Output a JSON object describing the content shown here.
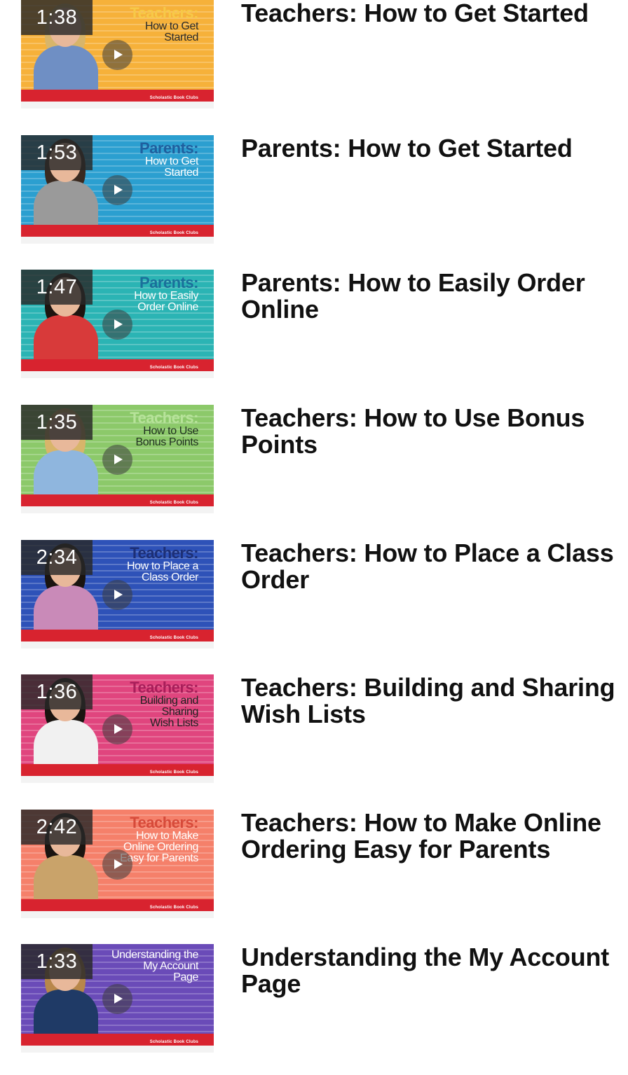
{
  "videos": [
    {
      "duration": "1:38",
      "title": "Teachers: How to Get Started",
      "thumb_heading": "Teachers:",
      "thumb_subheading": "How to Get\nStarted",
      "thumb_brand": "Scholastic Book Clubs",
      "bg_color": "#f6b13a",
      "heading_color": "#f7c948",
      "subheading_color": "#2a2a2a",
      "person_color": "#6f8fc4",
      "hair_color": "#d8b56a"
    },
    {
      "duration": "1:53",
      "title": "Parents: How to Get Started",
      "thumb_heading": "Parents:",
      "thumb_subheading": "How to Get\nStarted",
      "thumb_brand": "Scholastic Book Clubs",
      "bg_color": "#2b9fd0",
      "heading_color": "#1f5f9e",
      "subheading_color": "#ffffff",
      "person_color": "#9a9a9a",
      "hair_color": "#3a2a20"
    },
    {
      "duration": "1:47",
      "title": "Parents: How to Easily Order Online",
      "thumb_heading": "Parents:",
      "thumb_subheading": "How to Easily\nOrder Online",
      "thumb_brand": "Scholastic Book Clubs",
      "bg_color": "#2bb4b4",
      "heading_color": "#1a6f9a",
      "subheading_color": "#ffffff",
      "person_color": "#d83a3a",
      "hair_color": "#1e1410"
    },
    {
      "duration": "1:35",
      "title": "Teachers: How to Use Bonus Points",
      "thumb_heading": "Teachers:",
      "thumb_subheading": "How to Use\nBonus Points",
      "thumb_brand": "Scholastic Book Clubs",
      "bg_color": "#8cc96a",
      "heading_color": "#b7e39a",
      "subheading_color": "#1f2f1f",
      "person_color": "#8fb6de",
      "hair_color": "#d8b56a"
    },
    {
      "duration": "2:34",
      "title": "Teachers: How to Place a Class Order",
      "thumb_heading": "Teachers:",
      "thumb_subheading": "How to Place a\nClass Order",
      "thumb_brand": "Scholastic Book Clubs",
      "bg_color": "#2e52b8",
      "heading_color": "#1d2f75",
      "subheading_color": "#ffffff",
      "person_color": "#c98ab8",
      "hair_color": "#1a1410"
    },
    {
      "duration": "1:36",
      "title": "Teachers: Building and Sharing Wish Lists",
      "thumb_heading": "Teachers:",
      "thumb_subheading": "Building and\nSharing\nWish Lists",
      "thumb_brand": "Scholastic Book Clubs",
      "bg_color": "#e0457e",
      "heading_color": "#a81e5a",
      "subheading_color": "#222222",
      "person_color": "#f1f1f1",
      "hair_color": "#1a1410"
    },
    {
      "duration": "2:42",
      "title": "Teachers: How to Make Online Ordering Easy for Parents",
      "thumb_heading": "Teachers:",
      "thumb_subheading": "How to Make\nOnline Ordering\nEasy for Parents",
      "thumb_brand": "Scholastic Book Clubs",
      "bg_color": "#f5806a",
      "heading_color": "#d64a3a",
      "subheading_color": "#ffffff",
      "person_color": "#c9a36a",
      "hair_color": "#1a1410"
    },
    {
      "duration": "1:33",
      "title": "Understanding the My Account Page",
      "thumb_heading": "",
      "thumb_subheading": "Understanding the\nMy Account\nPage",
      "thumb_brand": "Scholastic Book Clubs",
      "bg_color": "#6a4bb8",
      "heading_color": "#ffffff",
      "subheading_color": "#ffffff",
      "person_color": "#1f3a66",
      "hair_color": "#b8874a"
    }
  ]
}
